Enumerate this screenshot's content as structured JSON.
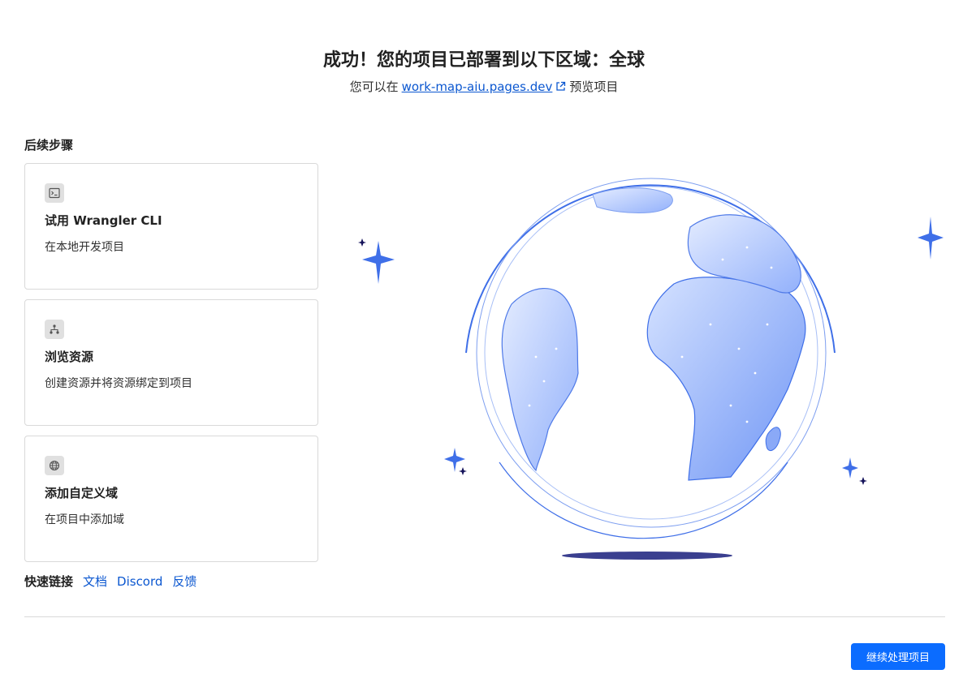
{
  "header": {
    "title": "成功！您的项目已部署到以下区域：全球",
    "sub_prefix": "您可以在",
    "preview_link": "work-map-aiu.pages.dev",
    "sub_suffix": "预览项目"
  },
  "next_steps": {
    "title": "后续步骤",
    "cards": [
      {
        "icon": "terminal-icon",
        "title": "试用 Wrangler CLI",
        "desc": "在本地开发项目"
      },
      {
        "icon": "hierarchy-icon",
        "title": "浏览资源",
        "desc": "创建资源并将资源绑定到项目"
      },
      {
        "icon": "globe-icon",
        "title": "添加自定义域",
        "desc": "在项目中添加域"
      }
    ]
  },
  "quick_links": {
    "label": "快速链接",
    "links": [
      "文档",
      "Discord",
      "反馈"
    ]
  },
  "footer": {
    "continue_label": "继续处理项目"
  },
  "colors": {
    "accent": "#0b6cff",
    "link": "#0b57d0",
    "globe_blue": "#3f6fe8"
  }
}
